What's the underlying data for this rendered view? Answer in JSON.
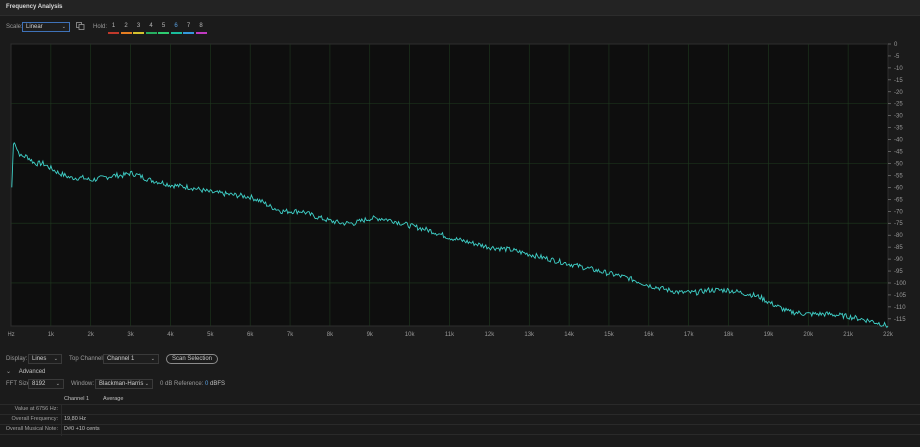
{
  "panel": {
    "title": "Frequency Analysis",
    "menu_icon": "hamburger-menu-icon"
  },
  "toolbar": {
    "scale_label": "Scale:",
    "scale_value": "Linear",
    "hold_label": "Hold:",
    "hold_buttons": [
      {
        "label": "1",
        "color": "#c0392b",
        "active": false
      },
      {
        "label": "2",
        "color": "#e67e22",
        "active": false
      },
      {
        "label": "3",
        "color": "#d4c12e",
        "active": false
      },
      {
        "label": "4",
        "color": "#27ae60",
        "active": false
      },
      {
        "label": "5",
        "color": "#2ecc71",
        "active": false
      },
      {
        "label": "6",
        "color": "#1abc9c",
        "active": true
      },
      {
        "label": "7",
        "color": "#3498db",
        "active": false
      },
      {
        "label": "8",
        "color": "#c03ac0",
        "active": false
      }
    ]
  },
  "chart_data": {
    "type": "line",
    "title": "",
    "xlabel": "",
    "ylabel": "",
    "x_unit": "Hz",
    "x_ticks": [
      "Hz",
      "1k",
      "2k",
      "3k",
      "4k",
      "5k",
      "6k",
      "7k",
      "8k",
      "9k",
      "10k",
      "11k",
      "12k",
      "13k",
      "14k",
      "15k",
      "16k",
      "17k",
      "18k",
      "19k",
      "20k",
      "21k",
      "22k"
    ],
    "xlim": [
      0,
      22000
    ],
    "y_ticks": [
      "0",
      "-5",
      "-10",
      "-15",
      "-20",
      "-25",
      "-30",
      "-35",
      "-40",
      "-45",
      "-50",
      "-55",
      "-60",
      "-65",
      "-70",
      "-75",
      "-80",
      "-85",
      "-90",
      "-95",
      "-100",
      "-105",
      "-110",
      "-115"
    ],
    "ylim": [
      -118,
      0
    ],
    "grid": true,
    "line_color": "#3fd0c8",
    "series": [
      {
        "x": [
          20,
          60,
          100,
          150,
          250,
          400,
          600,
          800,
          1000,
          1200,
          1500,
          1800,
          2000,
          2300,
          2600,
          2800,
          3000,
          3200,
          3500,
          3800,
          4000,
          4500,
          5000,
          5500,
          6000,
          6300,
          6500,
          6800,
          7000,
          7300,
          7600,
          8000,
          8300,
          8600,
          8800,
          9000,
          9300,
          9600,
          10000,
          10500,
          11000,
          11500,
          12000,
          12500,
          13000,
          13500,
          14000,
          14500,
          15000,
          15500,
          16000,
          16500,
          16800,
          17200,
          17500,
          17800,
          18000,
          18300,
          18600,
          18800,
          19000,
          19500,
          20000,
          20500,
          21000,
          21300,
          21600,
          21800,
          22000
        ],
        "y": [
          -60,
          -42,
          -41,
          -44,
          -47,
          -47,
          -50,
          -50,
          -52,
          -54,
          -56,
          -56,
          -57,
          -56,
          -55,
          -55,
          -54,
          -55,
          -57,
          -58,
          -59,
          -60,
          -62,
          -63,
          -64,
          -66,
          -68,
          -70,
          -70,
          -70,
          -72,
          -74,
          -75,
          -75,
          -74,
          -73,
          -73,
          -74,
          -76,
          -78,
          -81,
          -83,
          -85,
          -86,
          -88,
          -90,
          -92,
          -94,
          -96,
          -98,
          -101,
          -103,
          -104,
          -104,
          -103,
          -103,
          -103,
          -104,
          -105,
          -106,
          -108,
          -112,
          -113,
          -113,
          -114,
          -115,
          -116,
          -117,
          -118
        ]
      }
    ]
  },
  "controls": {
    "display_label": "Display:",
    "display_value": "Lines",
    "top_channel_label": "Top Channel:",
    "top_channel_value": "Channel 1",
    "scan_button": "Scan Selection",
    "advanced_label": "Advanced",
    "fft_label": "FFT Size:",
    "fft_value": "8192",
    "window_label": "Window:",
    "window_value": "Blackman-Harris",
    "ref_label": "0 dB Reference:",
    "ref_value": "0",
    "ref_unit": "dBFS"
  },
  "info_table": {
    "col1_header": "Channel 1",
    "col2_header": "Average",
    "rows": [
      {
        "label": "Value at 6756 Hz:",
        "value": ""
      },
      {
        "label": "Overall Frequency:",
        "value": "19,80 Hz"
      },
      {
        "label": "Overall Musical Note:",
        "value": "D#0 +10 cents"
      }
    ]
  }
}
